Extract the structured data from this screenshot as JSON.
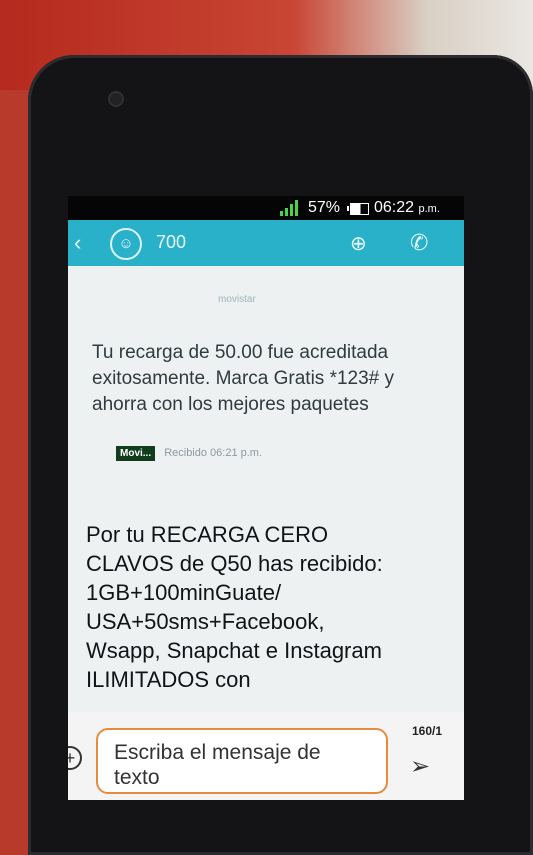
{
  "status": {
    "battery": "57%",
    "time": "06:22",
    "ampm": "p.m."
  },
  "conversation": {
    "contact": "700",
    "avatar_glyph": "☺"
  },
  "messages": [
    {
      "text": "Tu recarga de 50.00 fue acreditada exitosamente. Marca Gratis *123# y ahorra con los mejores paquetes",
      "carrier_logo": "Movi...",
      "time_label": "Recibido 06:21 p.m."
    },
    {
      "text": "Por tu RECARGA CERO CLAVOS de Q50 has recibido: 1GB+100minGuate/ USA+50sms+Facebook, Wsapp, Snapchat e Instagram ILIMITADOS con"
    }
  ],
  "composer": {
    "placeholder": "Escriba el mensaje de texto",
    "char_counter": "160/1"
  },
  "colors": {
    "appbar": "#29b1c9",
    "input_border": "#e68b3d",
    "signal": "#4bd24b"
  },
  "icons": [
    "back-arrow-icon",
    "avatar-icon",
    "attach-icon",
    "call-icon",
    "add-attachment-icon",
    "send-icon"
  ]
}
